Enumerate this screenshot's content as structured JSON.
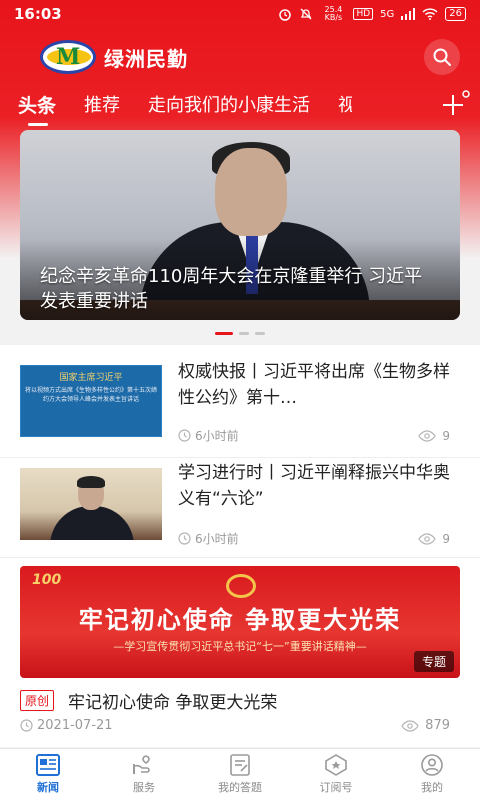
{
  "status_bar": {
    "time": "16:03",
    "network_speed": "25.4 KB/s",
    "hd_label": "HD",
    "signal_label": "5G",
    "battery": "26"
  },
  "header": {
    "brand": "绿洲民勤"
  },
  "tabs": [
    {
      "label": "头条",
      "active": true
    },
    {
      "label": "推荐",
      "active": false
    },
    {
      "label": "走向我们的小康生活",
      "active": false
    },
    {
      "label": "视",
      "active": false
    }
  ],
  "hero": {
    "caption": "纪念辛亥革命110周年大会在京隆重举行 习近平发表重要讲话",
    "page_count": 3,
    "current_page": 1
  },
  "news": [
    {
      "title": "权威快报丨习近平将出席《生物多样性公约》第十…",
      "time": "6小时前",
      "views": "9",
      "thumb_text_1": "国家主席习近平",
      "thumb_text_2": "将以视频方式出席《生物多样性公约》第十五次缔约方大会领导人峰会并发表主旨讲话"
    },
    {
      "title": "学习进行时丨习近平阐释振兴中华奥义有“六论”",
      "time": "6小时前",
      "views": "9"
    }
  ],
  "special": {
    "corner_label": "100",
    "headline": "牢记初心使命  争取更大光荣",
    "subline": "—学习宣传贯彻习近平总书记“七一”重要讲话精神—",
    "tag": "专题",
    "badge": "原创",
    "title": "牢记初心使命  争取更大光荣",
    "date": "2021-07-21",
    "views": "879"
  },
  "bottom_nav": [
    {
      "label": "新闻",
      "icon": "news-icon",
      "active": true
    },
    {
      "label": "服务",
      "icon": "service-icon",
      "active": false
    },
    {
      "label": "我的答题",
      "icon": "quiz-icon",
      "active": false
    },
    {
      "label": "订阅号",
      "icon": "subscription-icon",
      "active": false
    },
    {
      "label": "我的",
      "icon": "profile-icon",
      "active": false
    }
  ],
  "colors": {
    "brand_red": "#e8141b",
    "nav_active": "#1f6fd6",
    "muted": "#9a9a9a"
  }
}
